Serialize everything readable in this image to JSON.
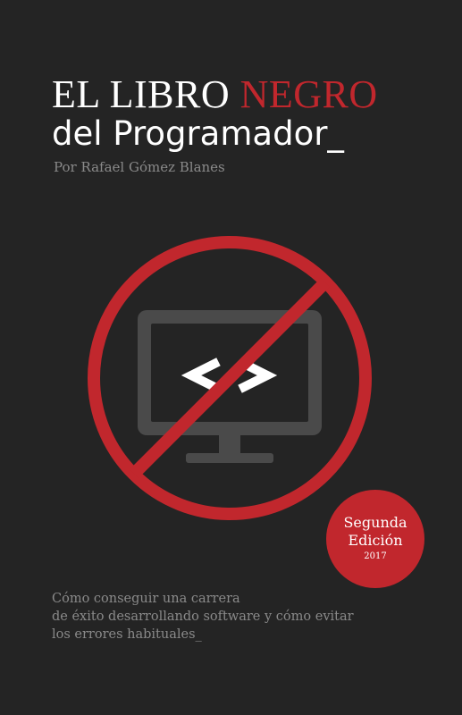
{
  "cover": {
    "title_prefix": "EL LIBRO ",
    "title_accent": "NEGRO",
    "title_line2": "del Programador_",
    "author": "Por Rafael Gómez Blanes",
    "badge": {
      "line1": "Segunda",
      "line2": "Edición",
      "year": "2017"
    },
    "subtitle": [
      "Cómo conseguir una carrera",
      "de éxito desarrollando software y cómo evitar",
      "los errores habituales_"
    ],
    "emblem_code_glyphs": "< >"
  },
  "colors": {
    "background": "#242424",
    "accent_red": "#c1272d",
    "title_white": "#ffffff",
    "muted_gray": "#8a8a8a",
    "monitor_gray": "#4a4a4a"
  },
  "icons": [
    "no-symbol-icon",
    "monitor-icon",
    "code-brackets-icon"
  ]
}
